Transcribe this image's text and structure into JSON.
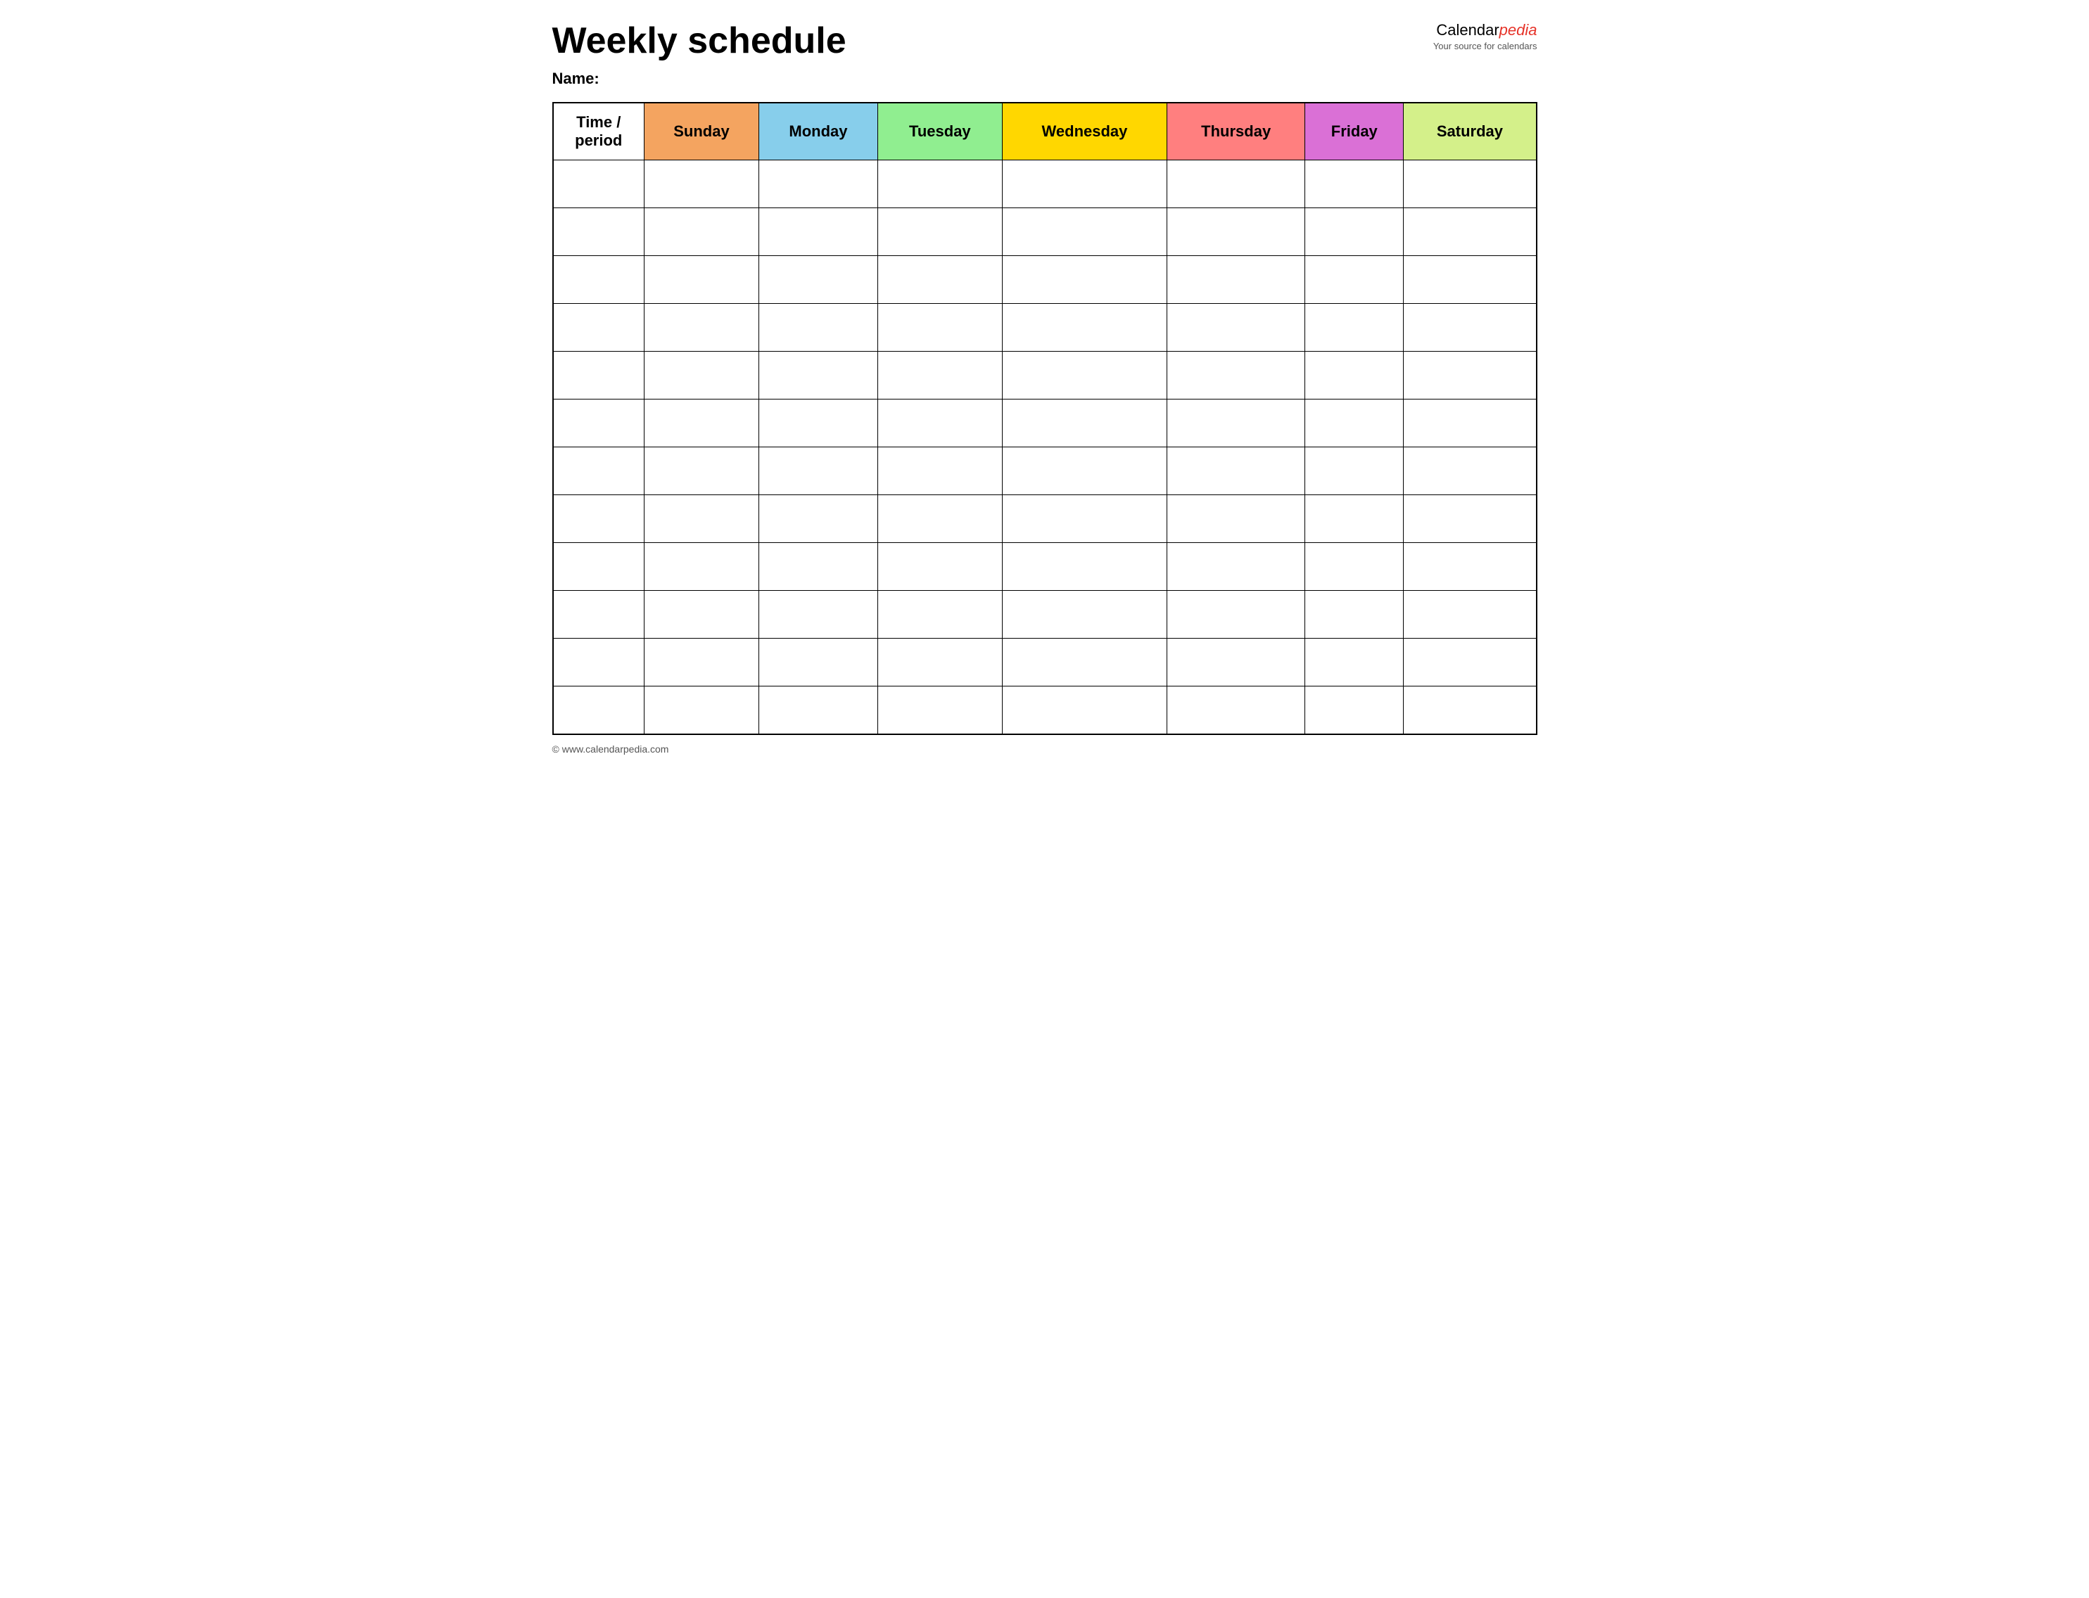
{
  "header": {
    "title": "Weekly schedule",
    "name_label": "Name:",
    "logo_calendar": "Calendar",
    "logo_pedia": "pedia",
    "logo_subtitle": "Your source for calendars"
  },
  "table": {
    "columns": [
      {
        "id": "time",
        "label": "Time / period",
        "class": "col-time"
      },
      {
        "id": "sunday",
        "label": "Sunday",
        "class": "col-sunday"
      },
      {
        "id": "monday",
        "label": "Monday",
        "class": "col-monday"
      },
      {
        "id": "tuesday",
        "label": "Tuesday",
        "class": "col-tuesday"
      },
      {
        "id": "wednesday",
        "label": "Wednesday",
        "class": "col-wednesday"
      },
      {
        "id": "thursday",
        "label": "Thursday",
        "class": "col-thursday"
      },
      {
        "id": "friday",
        "label": "Friday",
        "class": "col-friday"
      },
      {
        "id": "saturday",
        "label": "Saturday",
        "class": "col-saturday"
      }
    ],
    "row_count": 12
  },
  "footer": {
    "url": "www.calendarpedia.com"
  }
}
